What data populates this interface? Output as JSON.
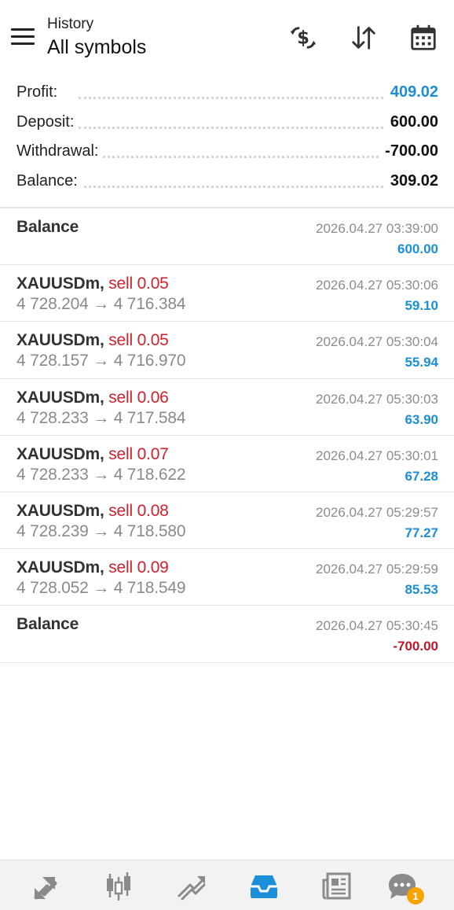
{
  "header": {
    "subtitle": "History",
    "title": "All symbols",
    "icons": [
      "menu-icon",
      "currency-exchange-icon",
      "sort-icon",
      "calendar-icon"
    ]
  },
  "summary": [
    {
      "label": "Profit:",
      "value": "409.02",
      "color": "#1a8fd8"
    },
    {
      "label": "Deposit:",
      "value": "600.00",
      "color": "#111111"
    },
    {
      "label": "Withdrawal:",
      "value": "-700.00",
      "color": "#111111"
    },
    {
      "label": "Balance:",
      "value": "309.02",
      "color": "#111111"
    }
  ],
  "items": [
    {
      "symbol": "Balance",
      "direction": "",
      "prices": "",
      "time": "2026.04.27 03:39:00",
      "amount": "600.00"
    },
    {
      "symbol": "XAUUSDm,",
      "direction": "sell 0.05",
      "prices": "4 728.204 → 4 716.384",
      "time": "2026.04.27 05:30:06",
      "amount": "59.10"
    },
    {
      "symbol": "XAUUSDm,",
      "direction": "sell 0.05",
      "prices": "4 728.157 → 4 716.970",
      "time": "2026.04.27 05:30:04",
      "amount": "55.94"
    },
    {
      "symbol": "XAUUSDm,",
      "direction": "sell 0.06",
      "prices": "4 728.233 → 4 717.584",
      "time": "2026.04.27 05:30:03",
      "amount": "63.90"
    },
    {
      "symbol": "XAUUSDm,",
      "direction": "sell 0.07",
      "prices": "4 728.233 → 4 718.622",
      "time": "2026.04.27 05:30:01",
      "amount": "67.28"
    },
    {
      "symbol": "XAUUSDm,",
      "direction": "sell 0.08",
      "prices": "4 728.239 → 4 718.580",
      "time": "2026.04.27 05:29:57",
      "amount": "77.27"
    },
    {
      "symbol": "XAUUSDm,",
      "direction": "sell 0.09",
      "prices": "4 728.052 → 4 718.549",
      "time": "2026.04.27 05:29:59",
      "amount": "85.53"
    },
    {
      "symbol": "Balance",
      "direction": "",
      "prices": "",
      "time": "2026.04.27 05:30:45",
      "amount": "-700.00"
    }
  ],
  "colors": {
    "accent": "#1a8fd8",
    "sell": "#d1202a",
    "negative": "#c0182a"
  },
  "bottom_nav": {
    "items": [
      "quotes-icon",
      "chart-icon",
      "trade-icon",
      "history-icon",
      "news-icon",
      "messages-icon"
    ],
    "active": "history-icon",
    "messages_badge": "1"
  }
}
